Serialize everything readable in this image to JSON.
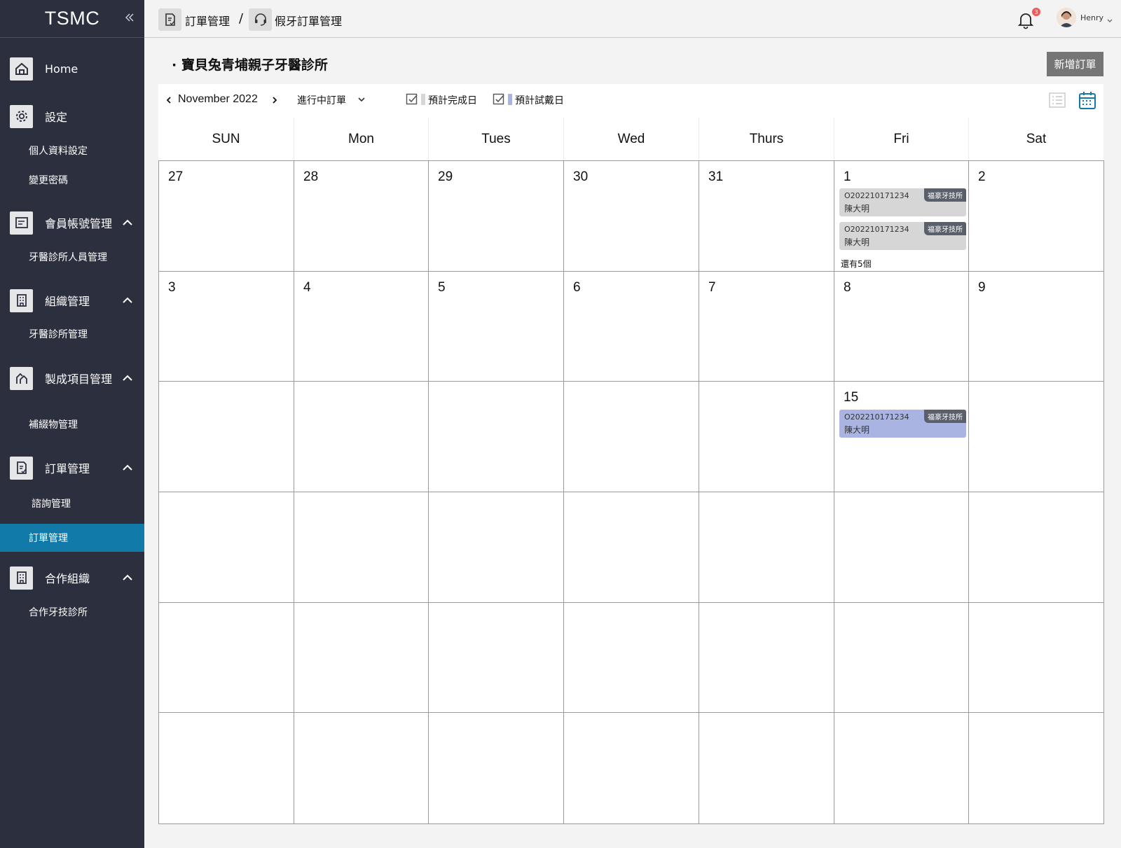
{
  "sidebar": {
    "brand": "TSMC",
    "groups": [
      {
        "label": "Home",
        "icon": "home-icon"
      },
      {
        "label": "設定",
        "icon": "gear-icon"
      },
      {
        "label": "會員帳號管理",
        "icon": "member-card-icon"
      },
      {
        "label": "組織管理",
        "icon": "building-icon"
      },
      {
        "label": "製成項目管理",
        "icon": "tools-icon"
      },
      {
        "label": "訂單管理",
        "icon": "order-icon"
      },
      {
        "label": "合作組織",
        "icon": "building-icon"
      }
    ],
    "subitems": {
      "settings": [
        "個人資料設定",
        "變更密碼"
      ],
      "members": [
        "牙醫診所人員管理"
      ],
      "org": [
        "牙醫診所管理"
      ],
      "products": [
        "補綴物管理"
      ],
      "orders": [
        "諮詢管理",
        "訂單管理"
      ],
      "partners": [
        "合作牙技診所"
      ]
    },
    "active_item": "訂單管理"
  },
  "header": {
    "breadcrumb": [
      "訂單管理",
      "假牙訂單管理"
    ],
    "separator": "/",
    "notification_count": "3",
    "user_name": "Henry"
  },
  "page": {
    "title": "· 寶貝兔青埔親子牙醫診所",
    "add_button": "新增訂單"
  },
  "toolbar": {
    "month": "November 2022",
    "filter": "進行中訂單",
    "legend": [
      {
        "label": "預計完成日",
        "color": "#d6d6d6",
        "checked": true
      },
      {
        "label": "預計試戴日",
        "color": "#a9b4e3",
        "checked": true
      }
    ],
    "active_view": "calendar"
  },
  "calendar": {
    "weekdays": [
      "SUN",
      "Mon",
      "Tues",
      "Wed",
      "Thurs",
      "Fri",
      "Sat"
    ],
    "days": [
      "27",
      "28",
      "29",
      "30",
      "31",
      "1",
      "2",
      "3",
      "4",
      "5",
      "6",
      "7",
      "8",
      "9",
      "",
      "",
      "",
      "",
      "",
      "15",
      "",
      "",
      "",
      "",
      "",
      "",
      "",
      "",
      "",
      "",
      "",
      "",
      "",
      "",
      "",
      "",
      "",
      "",
      "",
      "",
      "",
      ""
    ],
    "events": {
      "nov1": [
        {
          "code": "O202210171234",
          "name": "陳大明",
          "tag": "福豪牙技所",
          "type": "gray"
        },
        {
          "code": "O202210171234",
          "name": "陳大明",
          "tag": "福豪牙技所",
          "type": "gray"
        }
      ],
      "nov1_more": "還有5個",
      "nov15": [
        {
          "code": "O202210171234",
          "name": "陳大明",
          "tag": "福豪牙技所",
          "type": "blue"
        }
      ]
    }
  }
}
